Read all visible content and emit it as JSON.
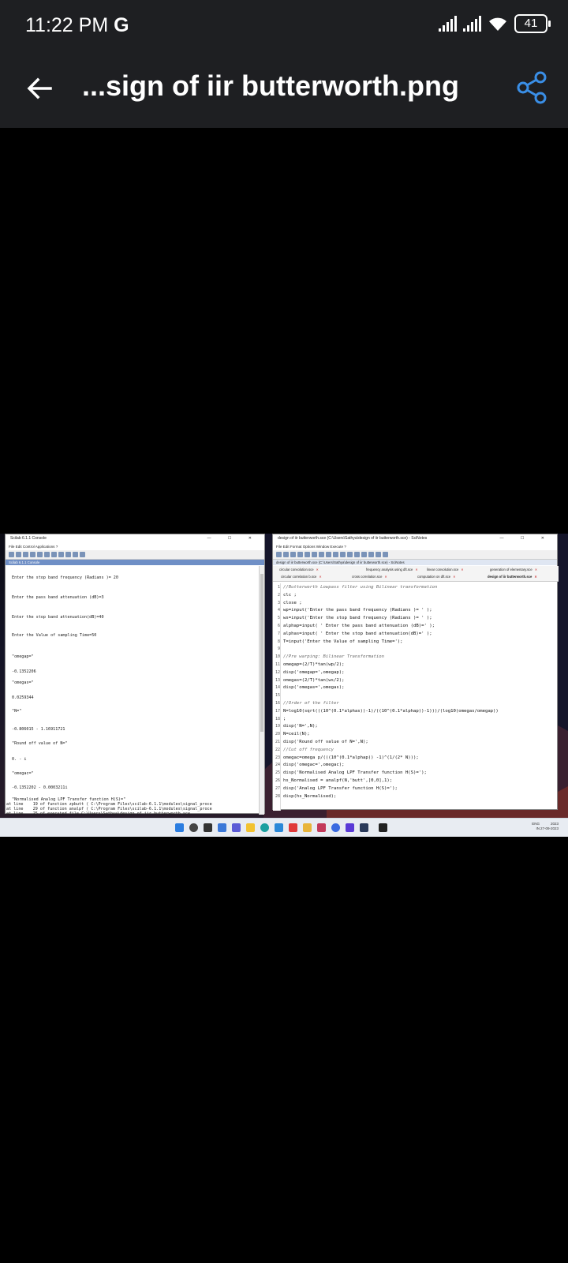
{
  "status_bar": {
    "time": "11:22 PM",
    "carrier_glyph": "G",
    "battery": "41",
    "icons": [
      "signal-icon",
      "signal-icon",
      "wifi-icon",
      "battery-icon"
    ]
  },
  "app_bar": {
    "title": "...sign of iir butterworth.png",
    "back_icon": "arrow-left-icon",
    "share_icon": "share-icon"
  },
  "screenshot": {
    "console": {
      "title": "Scilab 6.1.1 Console",
      "menu": "File  Edit  Control  Applications  ?",
      "subtitle": "Scilab 6.1.1 Console",
      "lines": [
        "Enter the stop band frequency (Radians )= 20",
        "Enter the pass band attenuation (dB)=3",
        "Enter the stop band attenuation(dB)=40",
        "Enter the Value of sampling Time=50",
        "\"omegap=\"",
        "-0.1352206",
        "\"omegas=\"",
        "0.0259344",
        "\"N=\"",
        "-0.806015 - 1.16911721",
        "\"Round off value of N=\"",
        "0. - i",
        "\"omegac=\"",
        "-0.1352202 - 0.0003211i",
        "\"Normalised Analog LPF Transfer function H(S)=\"",
        "at line    19 of function zpbutt ( C:\\Program Files\\scilab-6.1.1\\modules\\signal_proce",
        "at line    29 of function analpf ( C:\\Program Files\\scilab-6.1.1\\modules\\signal_proce",
        "at line    25 of executed file C:\\Users\\Sathya\\design of iir butterworth.sce",
        "ones: Wrong size for input argument #2: A scalar expected.",
        "-->"
      ]
    },
    "editor": {
      "title": "design of iir butterworth.sce (C:\\Users\\Sathya\\design of iir butterworth.sce) - SciNotes",
      "menu": "File  Edit  Format  Options  Window  Execute  ?",
      "path": "design of iir butterworth.sce (C:\\Users\\Sathya\\design of iir butterworth.sce) - SciNotes",
      "tabs_row1": [
        "circular convolution.sce",
        "frequency analysis using dft.sce",
        "linear convolution.sce",
        "generation of elementary.sce"
      ],
      "tabs_row2": [
        "circular correlation b.sce",
        "cross correlation.sce",
        "computation on dft.sce",
        "design of iir butterworth.sce"
      ],
      "code": [
        "//Butterworth Lowpass filter using Bilinear transformation",
        "clc ;",
        "close ;",
        "wp=input('Enter the pass band frequency (Radians )= ' );",
        "ws=input('Enter the stop band frequency (Radians )= ' );",
        "alphap=input( ' Enter the pass band attenuation (dB)=' );",
        "alphas=input( ' Enter the stop band attenuation(dB)=' );",
        "T=input('Enter the Value of sampling Time=');",
        "",
        "//Pre warping: Bilinear Transformation",
        "omegap=(2/T)*tan(wp/2);",
        "disp('omegap=',omegap);",
        "omegas=(2/T)*tan(ws/2);",
        "disp('omegas=',omegas);",
        "",
        "//Order of the filter",
        "N=log10(sqrt(((10^(0.1*alphas))-1)/((10^(0.1*alphap))-1)))/(log10(omegas/omegap))",
        ";",
        "disp('N=',N);",
        "N=ceil(N);",
        "disp('Round off value of N=',N);",
        "//Cut off frequency",
        "omegac=omega p/(((10^(0.1*alphap)) -1)^(1/(2* N)));",
        "disp('omegac=',omegac);",
        "disp('Normalised Analog LPF Transfer function H(S)=');",
        "hs_Normalised = analpf(N,'butt',[0,0],1);",
        "disp('Analog LPF Transfer function H(S)=');",
        "disp(hs_Normalised);"
      ]
    },
    "taskbar": {
      "lang": "ENG",
      "region": "IN",
      "date_top": "2023",
      "date_bottom": "27-09-2023"
    }
  }
}
